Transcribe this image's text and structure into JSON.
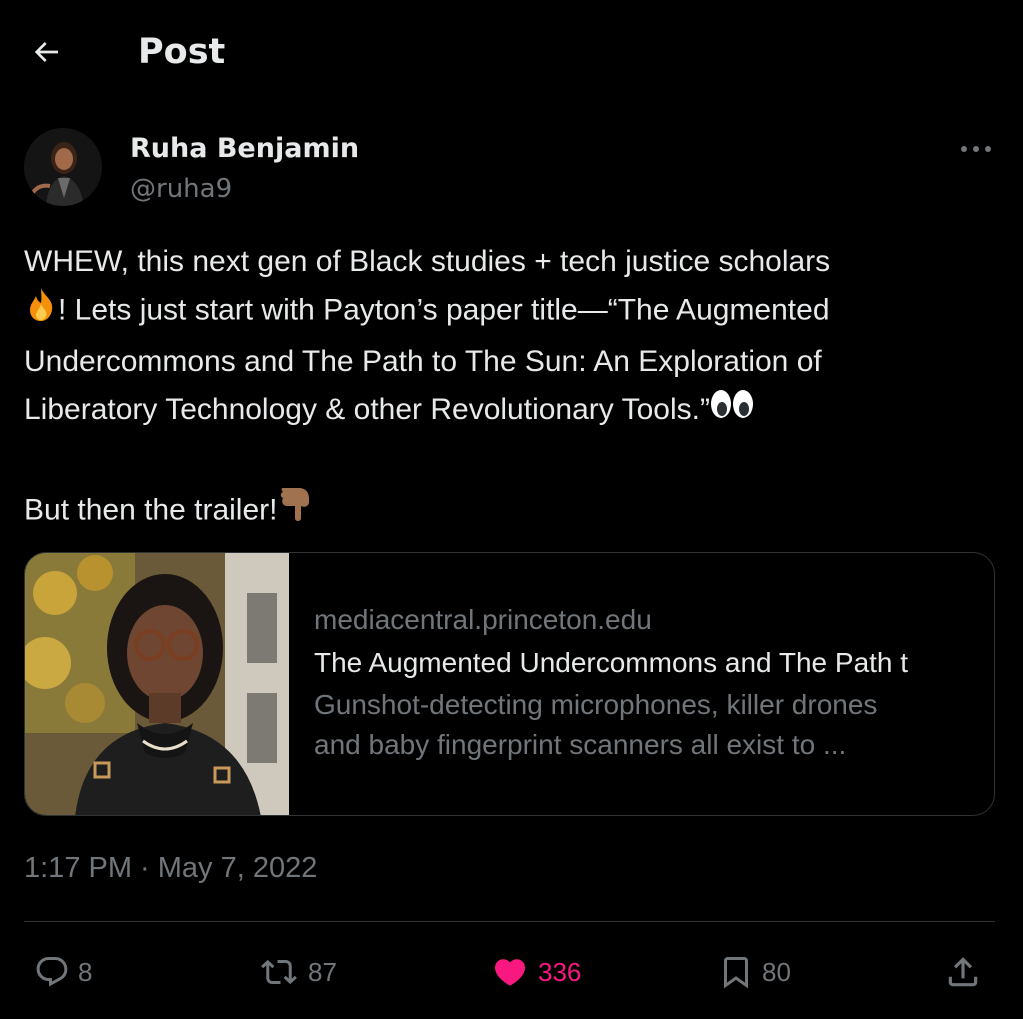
{
  "header": {
    "title": "Post"
  },
  "author": {
    "display_name": "Ruha Benjamin",
    "handle": "@ruha9"
  },
  "tweet": {
    "lines": [
      "WHEW, this next gen of Black studies + tech justice scholars",
      "! Lets just start with Payton’s paper title—“The Augmented",
      "Undercommons and The Path to The Sun: An Exploration of",
      "Liberatory Technology & other Revolutionary Tools.”",
      "But then the trailer!"
    ],
    "emojis": [
      "fire-emoji",
      "eyes-emoji",
      "pointing-down-emoji"
    ]
  },
  "card": {
    "domain": "mediacentral.princeton.edu",
    "title": "The Augmented Undercommons and The Path t",
    "description_line1": "Gunshot-detecting microphones, killer drones",
    "description_line2": "and baby fingerprint scanners all exist to ..."
  },
  "timestamp": "1:17 PM · May 7, 2022",
  "actions": {
    "replies": "8",
    "reposts": "87",
    "likes": "336",
    "bookmarks": "80"
  },
  "colors": {
    "background": "#000000",
    "text": "#e7e9ea",
    "secondary": "#71767b",
    "like": "#f91880",
    "border": "#2f3336"
  }
}
